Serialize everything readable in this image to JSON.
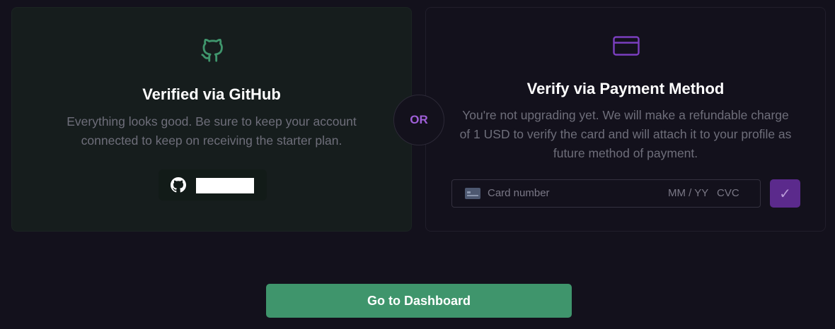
{
  "github_card": {
    "icon": "github-icon",
    "title": "Verified via GitHub",
    "description": "Everything looks good. Be sure to keep your account connected to keep on receiving the starter plan.",
    "account_icon": "github-mark-icon"
  },
  "divider": {
    "label": "OR"
  },
  "payment_card": {
    "icon": "credit-card-icon",
    "title": "Verify via Payment Method",
    "description": "You're not upgrading yet. We will make a refundable charge of 1 USD to verify the card and will attach it to your profile as future method of payment.",
    "card_number_placeholder": "Card number",
    "expiry_placeholder": "MM / YY",
    "cvc_placeholder": "CVC",
    "submit_label": "✓"
  },
  "footer": {
    "dashboard_label": "Go to Dashboard"
  },
  "colors": {
    "background": "#13111c",
    "github_accent": "#3f956c",
    "purple_accent": "#9f5fd8"
  }
}
